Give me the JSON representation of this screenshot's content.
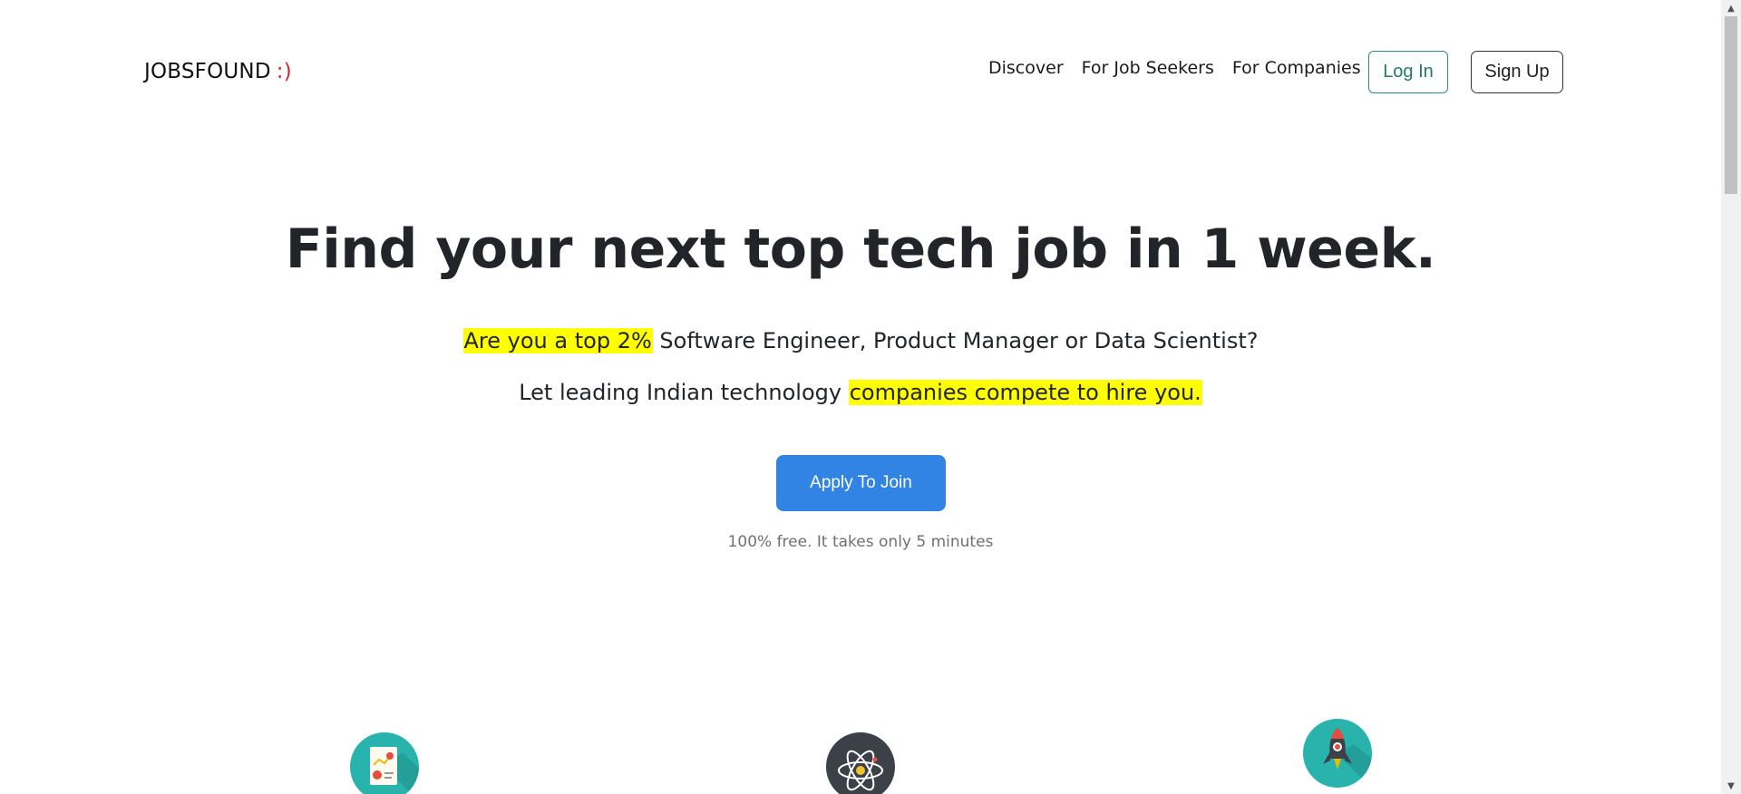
{
  "navbar": {
    "logo_text": "JOBSFOUND",
    "logo_smile": ":)",
    "links": [
      "Discover",
      "For Job Seekers",
      "For Companies"
    ],
    "login_label": "Log In",
    "signup_label": "Sign Up"
  },
  "hero": {
    "title": "Find your next top tech job in 1 week.",
    "line1_highlight": "Are you a top 2%",
    "line1_rest": " Software Engineer, Product Manager or Data Scientist?",
    "line2_start": "Let leading Indian technology ",
    "line2_highlight": "companies compete to hire you.",
    "cta_label": "Apply To Join",
    "cta_note": "100% free. It takes only 5 minutes"
  },
  "features": {
    "icons": [
      "report-chart-icon",
      "atom-icon",
      "rocket-icon"
    ]
  },
  "colors": {
    "accent": "#3184e4",
    "highlight": "#ffff00",
    "login_border": "#2d8f6f",
    "teal": "#28b4ad",
    "logo_smile": "#e0222d"
  },
  "scrollbar": {
    "up_glyph": "▲",
    "down_glyph": "▼"
  }
}
